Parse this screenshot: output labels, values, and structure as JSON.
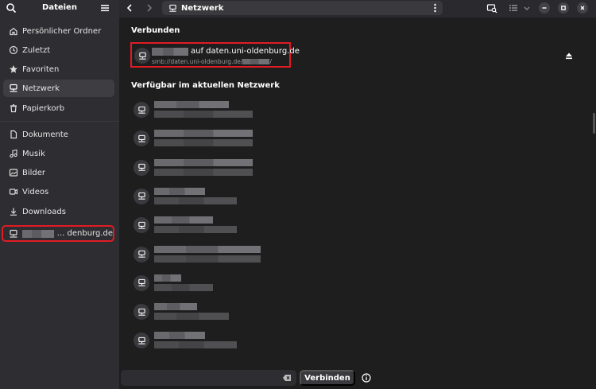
{
  "sidebar": {
    "title": "Dateien",
    "places": [
      {
        "label": "Persönlicher Ordner",
        "icon": "home-icon"
      },
      {
        "label": "Zuletzt",
        "icon": "clock-icon"
      },
      {
        "label": "Favoriten",
        "icon": "star-icon"
      },
      {
        "label": "Netzwerk",
        "icon": "network-icon",
        "active": true
      },
      {
        "label": "Papierkorb",
        "icon": "trash-icon"
      }
    ],
    "bookmarks": [
      {
        "label": "Dokumente",
        "icon": "document-icon"
      },
      {
        "label": "Musik",
        "icon": "music-icon"
      },
      {
        "label": "Bilder",
        "icon": "image-icon"
      },
      {
        "label": "Videos",
        "icon": "video-icon"
      },
      {
        "label": "Downloads",
        "icon": "download-icon"
      }
    ],
    "mount": {
      "label_suffix": "... denburg.de",
      "icon": "network-icon"
    }
  },
  "header": {
    "path_label": "Netzwerk"
  },
  "main": {
    "connected_title": "Verbunden",
    "connected_server": {
      "title_suffix": "auf daten.uni-oldenburg.de",
      "subtitle_prefix": "smb://daten.uni-oldenburg.de/",
      "subtitle_suffix": "/"
    },
    "available_title": "Verfügbar im aktuellen Netzwerk"
  },
  "bottom": {
    "connect_label": "Verbinden",
    "address_value": ""
  },
  "colors": {
    "highlight_border": "#e01b24",
    "sidebar_bg": "#2e2e32",
    "content_bg": "#1e1e1e"
  }
}
